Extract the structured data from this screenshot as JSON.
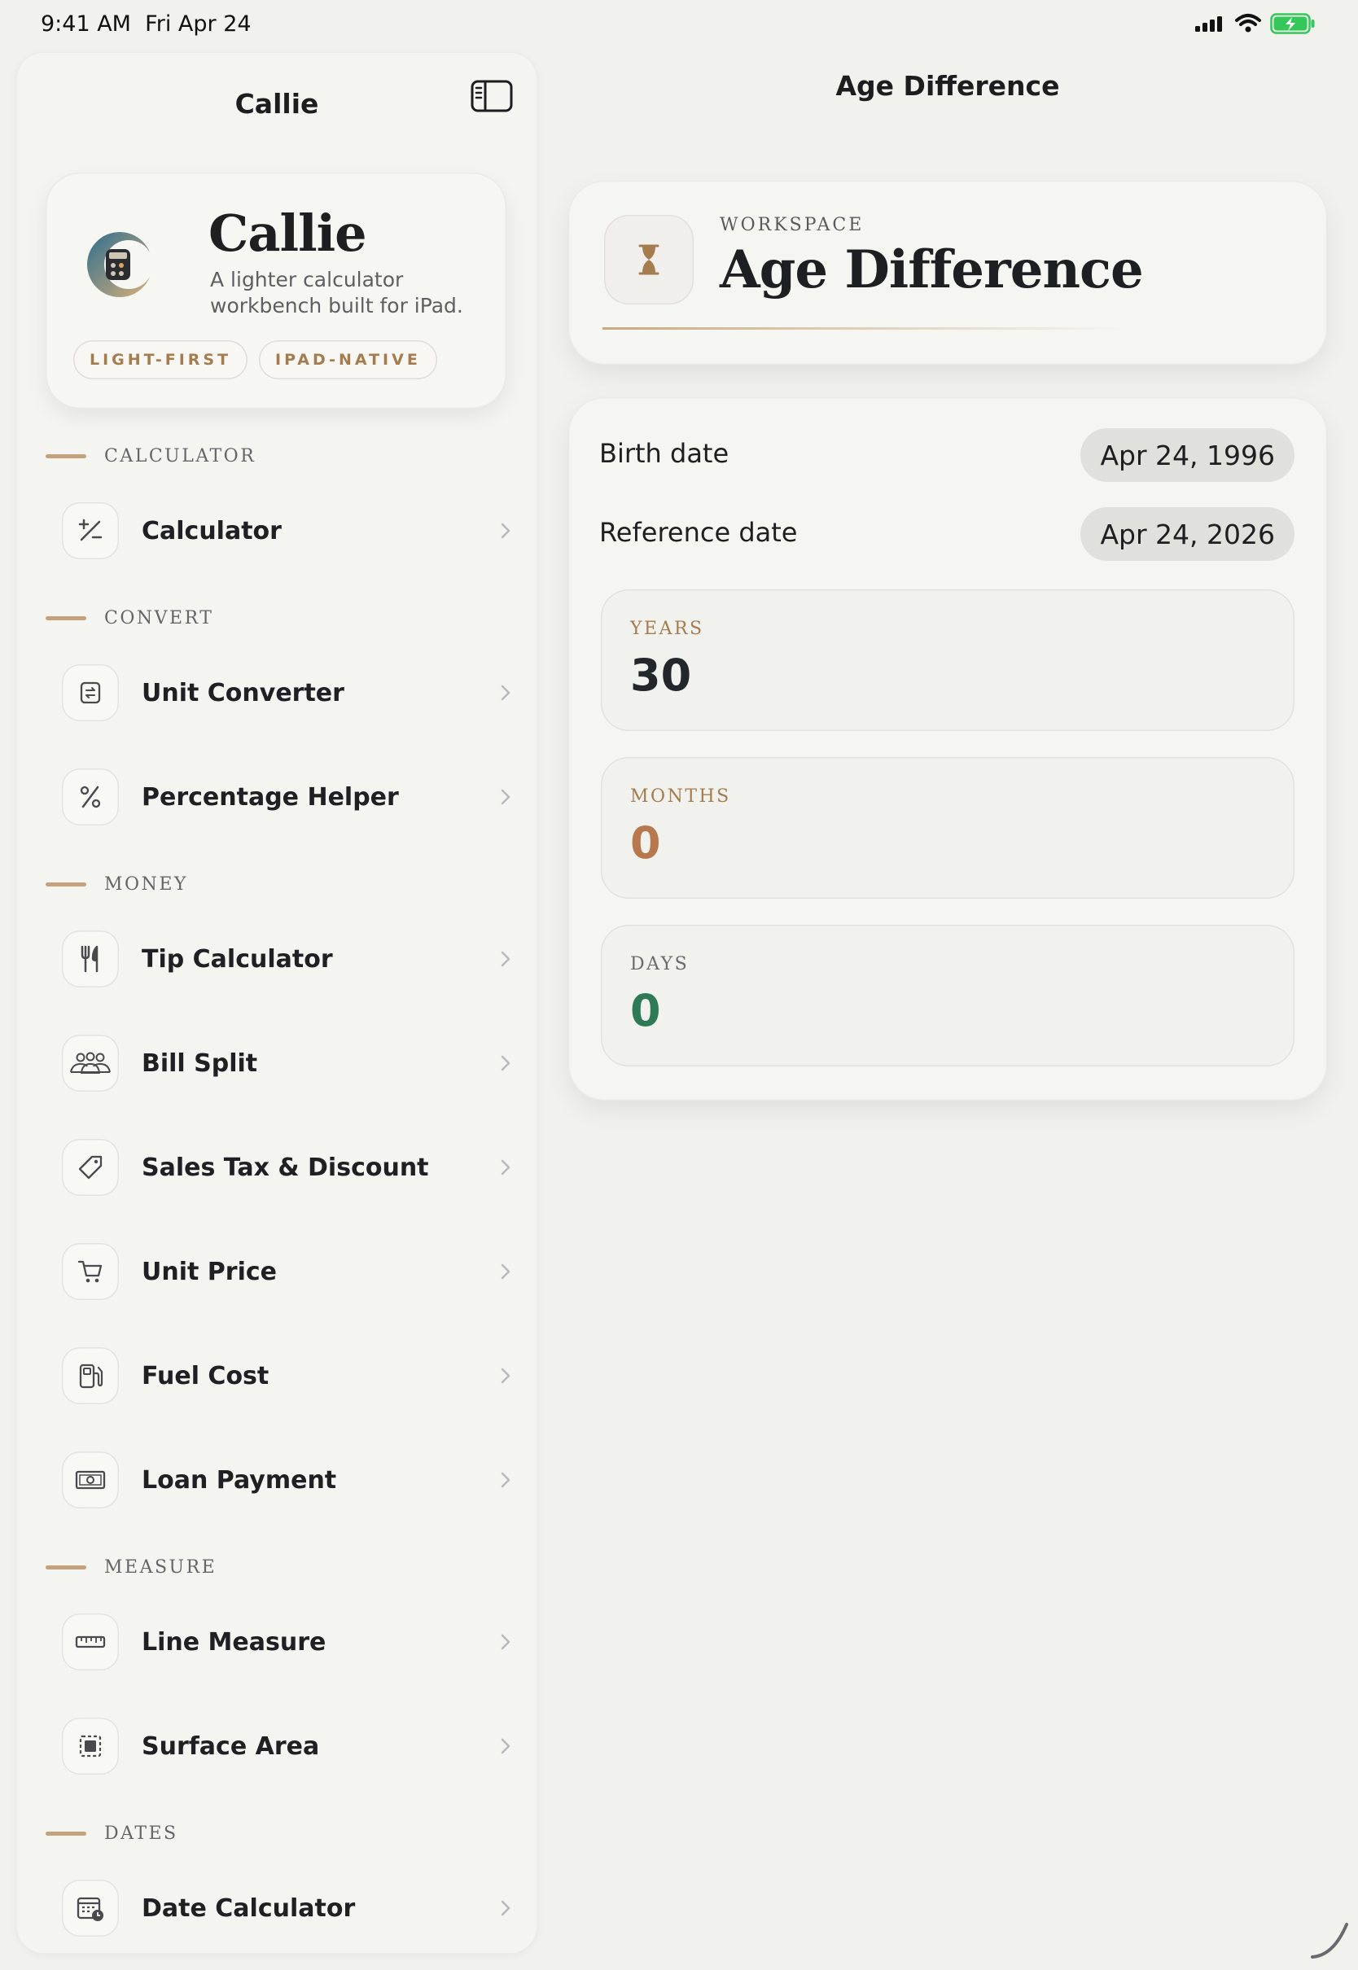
{
  "status_bar": {
    "time": "9:41 AM",
    "date": "Fri Apr 24"
  },
  "sidebar": {
    "title": "Callie",
    "hero": {
      "name": "Callie",
      "description": "A lighter calculator workbench built for iPad.",
      "tags": [
        "LIGHT-FIRST",
        "IPAD-NATIVE"
      ]
    },
    "sections": [
      {
        "title": "CALCULATOR",
        "items": [
          {
            "label": "Calculator",
            "icon": "plus-minus-icon"
          }
        ]
      },
      {
        "title": "CONVERT",
        "items": [
          {
            "label": "Unit Converter",
            "icon": "convert-icon"
          },
          {
            "label": "Percentage Helper",
            "icon": "percent-icon"
          }
        ]
      },
      {
        "title": "MONEY",
        "items": [
          {
            "label": "Tip Calculator",
            "icon": "fork-knife-icon"
          },
          {
            "label": "Bill Split",
            "icon": "people-icon"
          },
          {
            "label": "Sales Tax & Discount",
            "icon": "tag-icon"
          },
          {
            "label": "Unit Price",
            "icon": "cart-icon"
          },
          {
            "label": "Fuel Cost",
            "icon": "fuel-pump-icon"
          },
          {
            "label": "Loan Payment",
            "icon": "banknote-icon"
          }
        ]
      },
      {
        "title": "MEASURE",
        "items": [
          {
            "label": "Line Measure",
            "icon": "ruler-icon"
          },
          {
            "label": "Surface Area",
            "icon": "area-icon"
          }
        ]
      },
      {
        "title": "DATES",
        "items": [
          {
            "label": "Date Calculator",
            "icon": "calendar-clock-icon"
          }
        ]
      }
    ]
  },
  "main": {
    "title": "Age Difference",
    "workspace": {
      "kicker": "WORKSPACE",
      "title": "Age Difference",
      "icon": "hourglass-icon"
    },
    "birth_date": {
      "label": "Birth date",
      "value": "Apr 24, 1996"
    },
    "reference_date": {
      "label": "Reference date",
      "value": "Apr 24, 2026"
    },
    "stats": [
      {
        "label": "YEARS",
        "value": "30",
        "color": "#23262b",
        "label_color": "#a57c4e"
      },
      {
        "label": "MONTHS",
        "value": "0",
        "color": "#b8784e",
        "label_color": "#a57c4e"
      },
      {
        "label": "DAYS",
        "value": "0",
        "color": "#2e7a57",
        "label_color": "#6a6a6e"
      }
    ]
  },
  "colors": {
    "accent": "#c4a27e",
    "accent_text": "#a57c4e",
    "background": "#f1f1ee"
  }
}
